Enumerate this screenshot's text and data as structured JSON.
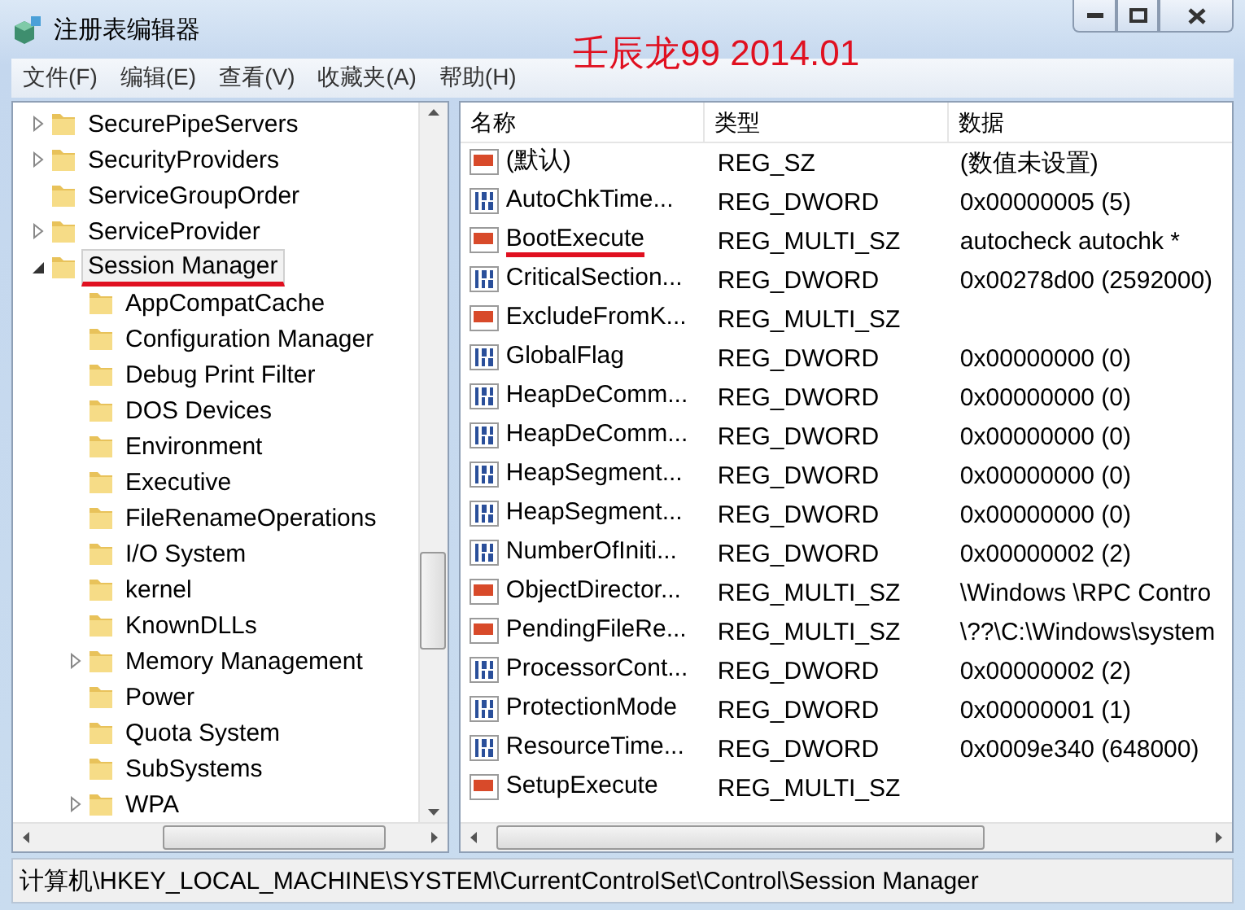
{
  "window": {
    "title": "注册表编辑器"
  },
  "annotation": "壬辰龙99 2014.01",
  "menu": [
    "文件(F)",
    "编辑(E)",
    "查看(V)",
    "收藏夹(A)",
    "帮助(H)"
  ],
  "tree": [
    {
      "label": "SecurePipeServers",
      "expandable": true,
      "expanded": false,
      "selected": false,
      "underlined": false
    },
    {
      "label": "SecurityProviders",
      "expandable": true,
      "expanded": false,
      "selected": false,
      "underlined": false
    },
    {
      "label": "ServiceGroupOrder",
      "expandable": false,
      "expanded": false,
      "selected": false,
      "underlined": false
    },
    {
      "label": "ServiceProvider",
      "expandable": true,
      "expanded": false,
      "selected": false,
      "underlined": false
    },
    {
      "label": "Session Manager",
      "expandable": true,
      "expanded": true,
      "selected": true,
      "underlined": true,
      "children": [
        {
          "label": "AppCompatCache",
          "expandable": false,
          "expanded": false,
          "selected": false,
          "underlined": false
        },
        {
          "label": "Configuration Manager",
          "expandable": false,
          "expanded": false,
          "selected": false,
          "underlined": false
        },
        {
          "label": "Debug Print Filter",
          "expandable": false,
          "expanded": false,
          "selected": false,
          "underlined": false
        },
        {
          "label": "DOS Devices",
          "expandable": false,
          "expanded": false,
          "selected": false,
          "underlined": false
        },
        {
          "label": "Environment",
          "expandable": false,
          "expanded": false,
          "selected": false,
          "underlined": false
        },
        {
          "label": "Executive",
          "expandable": false,
          "expanded": false,
          "selected": false,
          "underlined": false
        },
        {
          "label": "FileRenameOperations",
          "expandable": false,
          "expanded": false,
          "selected": false,
          "underlined": false
        },
        {
          "label": "I/O System",
          "expandable": false,
          "expanded": false,
          "selected": false,
          "underlined": false
        },
        {
          "label": "kernel",
          "expandable": false,
          "expanded": false,
          "selected": false,
          "underlined": false
        },
        {
          "label": "KnownDLLs",
          "expandable": false,
          "expanded": false,
          "selected": false,
          "underlined": false
        },
        {
          "label": "Memory Management",
          "expandable": true,
          "expanded": false,
          "selected": false,
          "underlined": false
        },
        {
          "label": "Power",
          "expandable": false,
          "expanded": false,
          "selected": false,
          "underlined": false
        },
        {
          "label": "Quota System",
          "expandable": false,
          "expanded": false,
          "selected": false,
          "underlined": false
        },
        {
          "label": "SubSystems",
          "expandable": false,
          "expanded": false,
          "selected": false,
          "underlined": false
        },
        {
          "label": "WPA",
          "expandable": true,
          "expanded": false,
          "selected": false,
          "underlined": false
        }
      ]
    }
  ],
  "table": {
    "columns": [
      "名称",
      "类型",
      "数据"
    ],
    "rows": [
      {
        "kind": "string",
        "name": "(默认)",
        "type": "REG_SZ",
        "data": "(数值未设置)",
        "underlined": false
      },
      {
        "kind": "number",
        "name": "AutoChkTime...",
        "type": "REG_DWORD",
        "data": "0x00000005 (5)",
        "underlined": false
      },
      {
        "kind": "string",
        "name": "BootExecute",
        "type": "REG_MULTI_SZ",
        "data": "autocheck autochk *",
        "underlined": true
      },
      {
        "kind": "number",
        "name": "CriticalSection...",
        "type": "REG_DWORD",
        "data": "0x00278d00 (2592000)",
        "underlined": false
      },
      {
        "kind": "string",
        "name": "ExcludeFromK...",
        "type": "REG_MULTI_SZ",
        "underlined": false
      },
      {
        "kind": "number",
        "name": "GlobalFlag",
        "type": "REG_DWORD",
        "data": "0x00000000 (0)",
        "underlined": false
      },
      {
        "kind": "number",
        "name": "HeapDeComm...",
        "type": "REG_DWORD",
        "data": "0x00000000 (0)",
        "underlined": false
      },
      {
        "kind": "number",
        "name": "HeapDeComm...",
        "type": "REG_DWORD",
        "data": "0x00000000 (0)",
        "underlined": false
      },
      {
        "kind": "number",
        "name": "HeapSegment...",
        "type": "REG_DWORD",
        "data": "0x00000000 (0)",
        "underlined": false
      },
      {
        "kind": "number",
        "name": "HeapSegment...",
        "type": "REG_DWORD",
        "data": "0x00000000 (0)",
        "underlined": false
      },
      {
        "kind": "number",
        "name": "NumberOfIniti...",
        "type": "REG_DWORD",
        "data": "0x00000002 (2)",
        "underlined": false
      },
      {
        "kind": "string",
        "name": "ObjectDirector...",
        "type": "REG_MULTI_SZ",
        "data": "\\Windows \\RPC Contro",
        "underlined": false
      },
      {
        "kind": "string",
        "name": "PendingFileRe...",
        "type": "REG_MULTI_SZ",
        "data": "\\??\\C:\\Windows\\system",
        "underlined": false
      },
      {
        "kind": "number",
        "name": "ProcessorCont...",
        "type": "REG_DWORD",
        "data": "0x00000002 (2)",
        "underlined": false
      },
      {
        "kind": "number",
        "name": "ProtectionMode",
        "type": "REG_DWORD",
        "data": "0x00000001 (1)",
        "underlined": false
      },
      {
        "kind": "number",
        "name": "ResourceTime...",
        "type": "REG_DWORD",
        "data": "0x0009e340 (648000)",
        "underlined": false
      },
      {
        "kind": "string",
        "name": "SetupExecute",
        "type": "REG_MULTI_SZ",
        "underlined": false
      }
    ]
  },
  "status_bar": "计算机\\HKEY_LOCAL_MACHINE\\SYSTEM\\CurrentControlSet\\Control\\Session Manager"
}
